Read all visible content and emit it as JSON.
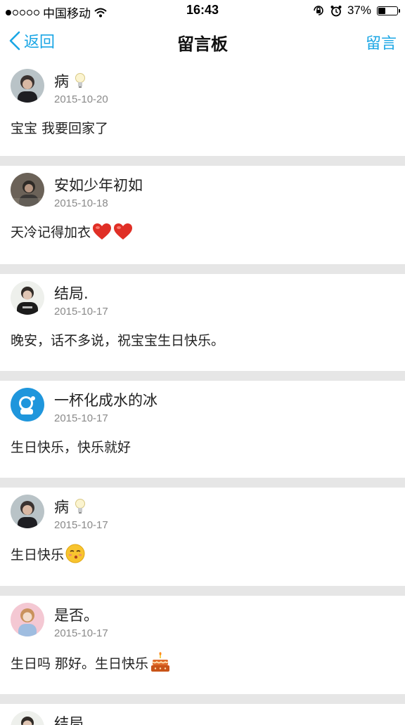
{
  "status_bar": {
    "carrier": "中国移动",
    "time": "16:43",
    "battery": "37%",
    "battery_level": 0.37
  },
  "nav": {
    "back_label": "返回",
    "title": "留言板",
    "action_label": "留言"
  },
  "messages": [
    {
      "name": "病",
      "date": "2015-10-20",
      "text": "宝宝 我要回家了",
      "name_icon": "lightbulb-icon",
      "emoji": ""
    },
    {
      "name": "安如少年初如",
      "date": "2015-10-18",
      "text": "天冷记得加衣",
      "emoji": "heart-icon"
    },
    {
      "name": "结局.",
      "date": "2015-10-17",
      "text": "晚安，话不多说，祝宝宝生日快乐。",
      "emoji": ""
    },
    {
      "name": "一杯化成水的冰",
      "date": "2015-10-17",
      "text": "生日快乐，快乐就好",
      "emoji": ""
    },
    {
      "name": "病",
      "date": "2015-10-17",
      "text": "生日快乐",
      "name_icon": "lightbulb-icon",
      "emoji": "kissing-face-icon"
    },
    {
      "name": "是否。",
      "date": "2015-10-17",
      "text": "生日吗 那好。生日快乐",
      "emoji": "birthday-cake-icon"
    },
    {
      "name": "结局.",
      "date": "",
      "text": "",
      "emoji": ""
    }
  ],
  "colors": {
    "accent": "#1aa6e5",
    "separator": "#e6e6e6",
    "date_text": "#8a8a8a"
  }
}
